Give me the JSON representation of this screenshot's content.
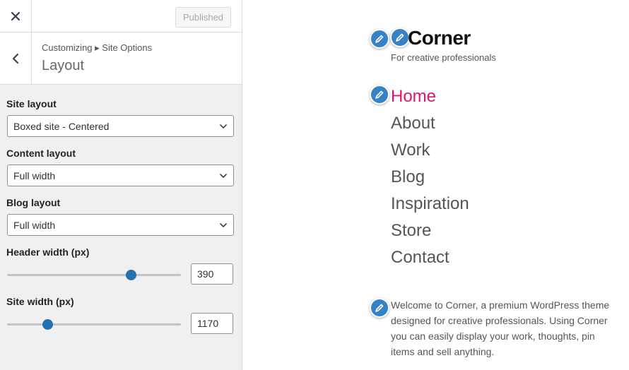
{
  "topbar": {
    "close_icon": "close-icon",
    "publish_label": "Published"
  },
  "section": {
    "breadcrumb": "Customizing ▸ Site Options",
    "title": "Layout"
  },
  "controls": {
    "site_layout": {
      "label": "Site layout",
      "value": "Boxed site - Centered"
    },
    "content_layout": {
      "label": "Content layout",
      "value": "Full width"
    },
    "blog_layout": {
      "label": "Blog layout",
      "value": "Full width"
    },
    "header_width": {
      "label": "Header width (px)",
      "value": "390",
      "slider_fraction": 0.71
    },
    "site_width": {
      "label": "Site width (px)",
      "value": "1170",
      "slider_fraction": 0.23
    }
  },
  "preview": {
    "logo": "Corner",
    "tagline": "For creative professionals",
    "nav": [
      {
        "label": "Home",
        "active": true
      },
      {
        "label": "About",
        "active": false
      },
      {
        "label": "Work",
        "active": false
      },
      {
        "label": "Blog",
        "active": false
      },
      {
        "label": "Inspiration",
        "active": false
      },
      {
        "label": "Store",
        "active": false
      },
      {
        "label": "Contact",
        "active": false
      }
    ],
    "intro": "Welcome to Corner, a premium WordPress theme designed for creative professionals. Using Corner you can easily display your work, thoughts, pin items and sell anything."
  },
  "colors": {
    "accent": "#2271b1",
    "nav_active": "#e2136e",
    "edit_pin": "#3582c4"
  }
}
